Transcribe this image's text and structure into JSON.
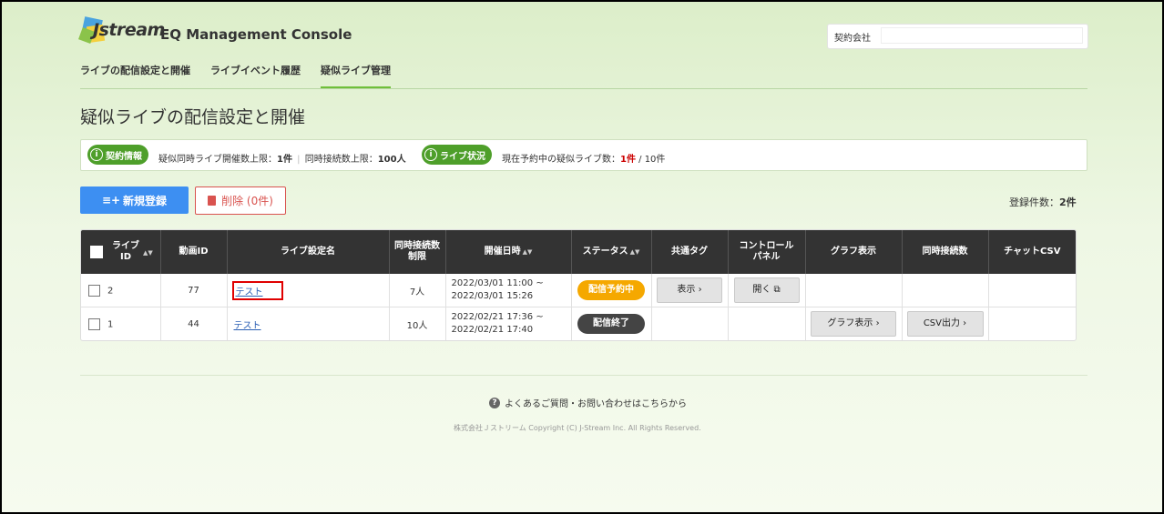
{
  "header": {
    "logo_text": "Jstream",
    "app_title": "EQ Management Console",
    "company_label": "契約会社",
    "company_value": ""
  },
  "nav": {
    "items": [
      {
        "label": "ライブの配信設定と開催"
      },
      {
        "label": "ライブイベント履歴"
      },
      {
        "label": "疑似ライブ管理"
      }
    ]
  },
  "page_title": "疑似ライブの配信設定と開催",
  "info": {
    "contract_pill": "契約情報",
    "contract_text_1": "疑似同時ライブ開催数上限：",
    "contract_value_1": "1件",
    "separator": "|",
    "contract_text_2": "同時接続数上限：",
    "contract_value_2": "100人",
    "status_pill": "ライブ状況",
    "status_text": "現在予約中の疑似ライブ数：",
    "status_value": "1件",
    "status_total": " / 10件"
  },
  "actions": {
    "new_label": "新規登録",
    "delete_label": "削除 (0件)",
    "count_label": "登録件数：",
    "count_value": "2件"
  },
  "table": {
    "headers": {
      "live_id": "ライブID",
      "video_id": "動画ID",
      "name": "ライブ設定名",
      "limit": "同時接続数制限",
      "datetime": "開催日時",
      "status": "ステータス",
      "tag": "共通タグ",
      "control": "コントロールパネル",
      "graph": "グラフ表示",
      "concurrent": "同時接続数",
      "chat": "チャットCSV"
    },
    "rows": [
      {
        "live_id": "2",
        "video_id": "77",
        "name": "テスト",
        "limit": "7人",
        "start": "2022/03/01 11:00 ~",
        "end": "2022/03/01 15:26",
        "status": "配信予約中",
        "tag_btn": "表示",
        "control_btn": "開く"
      },
      {
        "live_id": "1",
        "video_id": "44",
        "name": "テスト",
        "limit": "10人",
        "start": "2022/02/21 17:36 ~",
        "end": "2022/02/21 17:40",
        "status": "配信終了",
        "graph_btn": "グラフ表示",
        "csv_btn": "CSV出力"
      }
    ]
  },
  "footer": {
    "faq": "よくあるご質問・お問い合わせはこちらから",
    "copyright": "株式会社Ｊストリーム Copyright (C) J-Stream Inc. All Rights Reserved."
  },
  "colors": {
    "primary": "#3d8ff2",
    "green": "#4e9f2a",
    "danger": "#d9534f",
    "waiting": "#f5a800",
    "ended": "#444444"
  }
}
